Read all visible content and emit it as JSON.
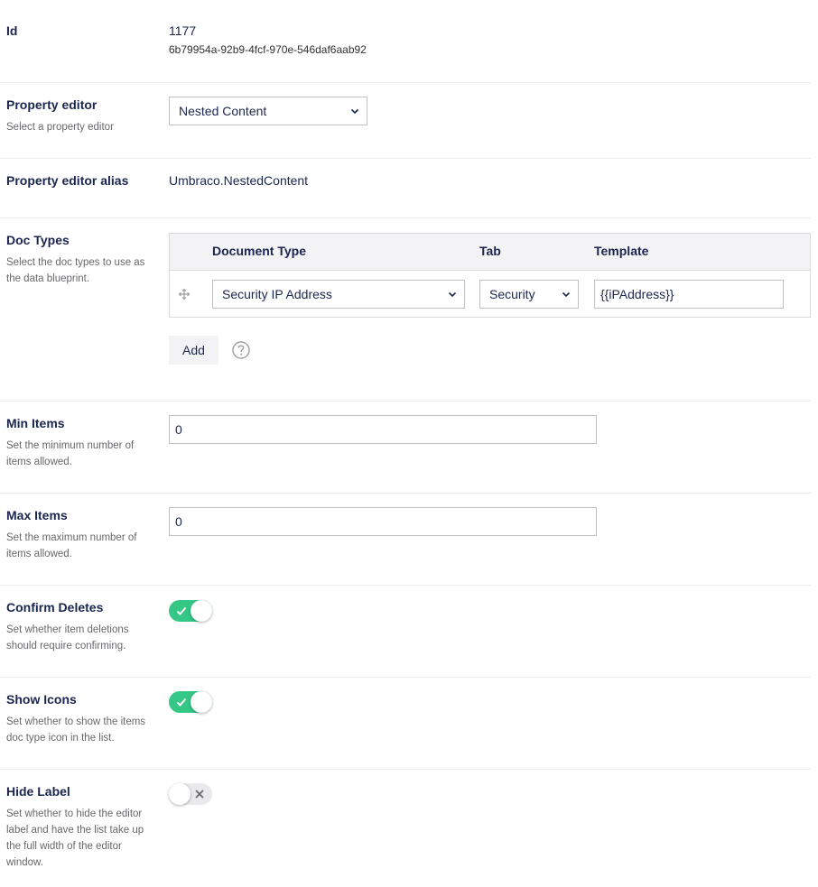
{
  "id": {
    "label": "Id",
    "number": "1177",
    "guid": "6b79954a-92b9-4fcf-970e-546daf6aab92"
  },
  "property_editor": {
    "label": "Property editor",
    "description": "Select a property editor",
    "selected": "Nested Content"
  },
  "property_editor_alias": {
    "label": "Property editor alias",
    "value": "Umbraco.NestedContent"
  },
  "doc_types": {
    "label": "Doc Types",
    "description": "Select the doc types to use as the data blueprint.",
    "columns": {
      "document_type": "Document Type",
      "tab": "Tab",
      "template": "Template"
    },
    "rows": [
      {
        "document_type": "Security IP Address",
        "tab": "Security",
        "template": "{{iPAddress}}"
      }
    ],
    "add_label": "Add"
  },
  "min_items": {
    "label": "Min Items",
    "description": "Set the minimum number of items allowed.",
    "value": "0"
  },
  "max_items": {
    "label": "Max Items",
    "description": "Set the maximum number of items allowed.",
    "value": "0"
  },
  "confirm_deletes": {
    "label": "Confirm Deletes",
    "description": "Set whether item deletions should require confirming.",
    "enabled": true
  },
  "show_icons": {
    "label": "Show Icons",
    "description": "Set whether to show the items doc type icon in the list.",
    "enabled": true
  },
  "hide_label": {
    "label": "Hide Label",
    "description": "Set whether to hide the editor label and have the list take up the full width of the editor window.",
    "enabled": false
  },
  "colors": {
    "toggle_on": "#35c786",
    "toggle_off": "#e9e9eb",
    "text": "#1b264f"
  },
  "icons": {
    "chevron": "chevron-down-icon",
    "drag": "drag-handle-icon",
    "help": "help-icon",
    "check": "check-icon",
    "cross": "close-icon"
  }
}
